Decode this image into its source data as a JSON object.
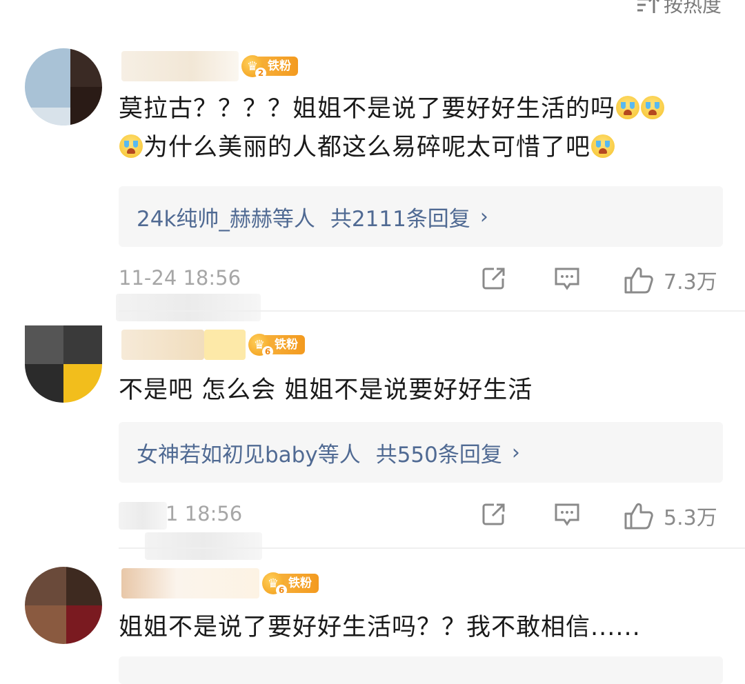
{
  "sort": {
    "label": "按热度"
  },
  "comments": [
    {
      "badge": {
        "level": "2",
        "label": "铁粉"
      },
      "text": [
        "莫拉古？？？？姐姐不是说了要好好生活的吗",
        "为什么美丽的人都这么易碎呢太可惜了吧"
      ],
      "replies": {
        "users": "24k纯帅_赫赫等人",
        "count": "共2111条回复"
      },
      "time": "11-24 18:56",
      "likes": "7.3万"
    },
    {
      "badge": {
        "level": "6",
        "label": "铁粉"
      },
      "text": [
        "不是吧 怎么会 姐姐不是说要好好生活"
      ],
      "replies": {
        "users": "女神若如初见baby等人",
        "count": "共550条回复"
      },
      "time": "1 18:56",
      "likes": "5.3万"
    },
    {
      "badge": {
        "level": "6",
        "label": "铁粉"
      },
      "text": [
        "姐姐不是说了要好好生活吗？？我不敢相信......"
      ]
    }
  ],
  "colors": {
    "link": "#506a93",
    "badge": "#f39a1f",
    "meta": "#a6a6a6"
  },
  "icons": [
    "sort-icon",
    "repost-icon",
    "comment-icon",
    "like-icon",
    "cry-emoji",
    "crown-badge-icon",
    "chevron-right-icon"
  ]
}
